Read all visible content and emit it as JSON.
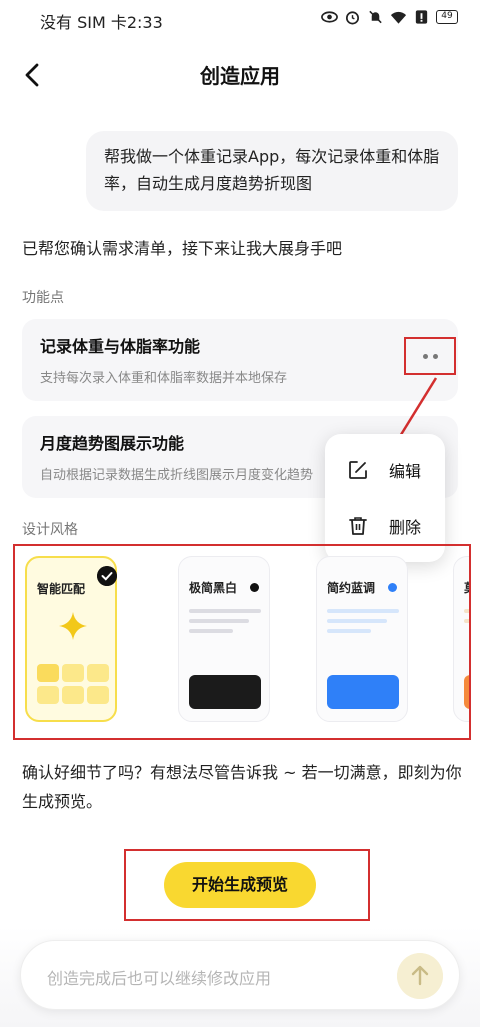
{
  "status_bar": {
    "carrier_time": "没有 SIM 卡2:33",
    "battery": "49",
    "icons": [
      "eye-icon",
      "alarm-icon",
      "mute-icon",
      "wifi-icon",
      "alert-icon",
      "battery-icon"
    ]
  },
  "header": {
    "title": "创造应用",
    "back_icon": "back-arrow-icon"
  },
  "user_message": "帮我做一个体重记录App，每次记录体重和体脂率，自动生成月度趋势折现图",
  "assistant_message": "已帮您确认需求清单，接下来让我大展身手吧",
  "features_label": "功能点",
  "features": [
    {
      "title": "记录体重与体脂率功能",
      "desc": "支持每次录入体重和体脂率数据并本地保存"
    },
    {
      "title": "月度趋势图展示功能",
      "desc": "自动根据记录数据生成折线图展示月度变化趋势"
    }
  ],
  "menu": {
    "items": [
      {
        "label": "编辑",
        "icon": "edit-icon"
      },
      {
        "label": "删除",
        "icon": "trash-icon"
      }
    ]
  },
  "design_style_label": "设计风格",
  "styles": [
    {
      "name": "智能匹配",
      "selected": true
    },
    {
      "name": "极简黑白",
      "accent": "#111111"
    },
    {
      "name": "简约蓝调",
      "accent": "#2f80f8"
    },
    {
      "name": "莫",
      "accent": "#f58a3c"
    }
  ],
  "confirm_message": "确认好细节了吗？有想法尽管告诉我 ~ 若一切满意，即刻为你生成预览。",
  "generate_button": "开始生成预览",
  "input": {
    "placeholder": "创造完成后也可以继续修改应用"
  },
  "colors": {
    "accent_yellow": "#f9d830",
    "highlight_red": "#d32f2f",
    "blue": "#2f80f8"
  }
}
